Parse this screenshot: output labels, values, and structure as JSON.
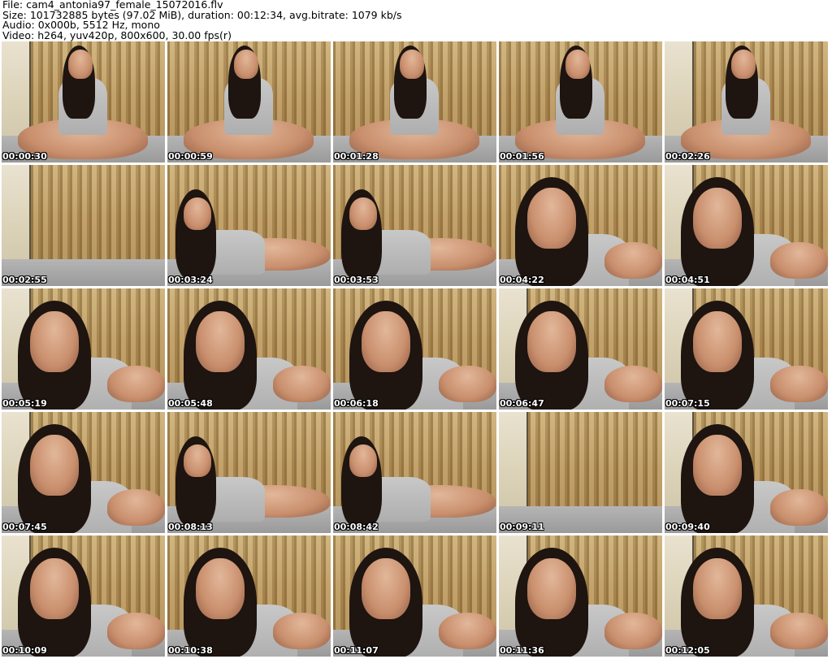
{
  "header": {
    "file_line": "File: cam4_antonia97_female_15072016.flv",
    "size_line": "Size: 101732885 bytes (97.02 MiB), duration: 00:12:34, avg.bitrate: 1079 kb/s",
    "audio_line": "Audio: 0x000b, 5512 Hz, mono",
    "video_line": "Video: h264, yuv420p, 800x600, 30.00 fps(r)"
  },
  "thumbnails": [
    {
      "time": "00:00:30"
    },
    {
      "time": "00:00:59"
    },
    {
      "time": "00:01:28"
    },
    {
      "time": "00:01:56"
    },
    {
      "time": "00:02:26"
    },
    {
      "time": "00:02:55"
    },
    {
      "time": "00:03:24"
    },
    {
      "time": "00:03:53"
    },
    {
      "time": "00:04:22"
    },
    {
      "time": "00:04:51"
    },
    {
      "time": "00:05:19"
    },
    {
      "time": "00:05:48"
    },
    {
      "time": "00:06:18"
    },
    {
      "time": "00:06:47"
    },
    {
      "time": "00:07:15"
    },
    {
      "time": "00:07:45"
    },
    {
      "time": "00:08:13"
    },
    {
      "time": "00:08:42"
    },
    {
      "time": "00:09:11"
    },
    {
      "time": "00:09:40"
    },
    {
      "time": "00:10:09"
    },
    {
      "time": "00:10:38"
    },
    {
      "time": "00:11:07"
    },
    {
      "time": "00:11:36"
    },
    {
      "time": "00:12:05"
    }
  ]
}
